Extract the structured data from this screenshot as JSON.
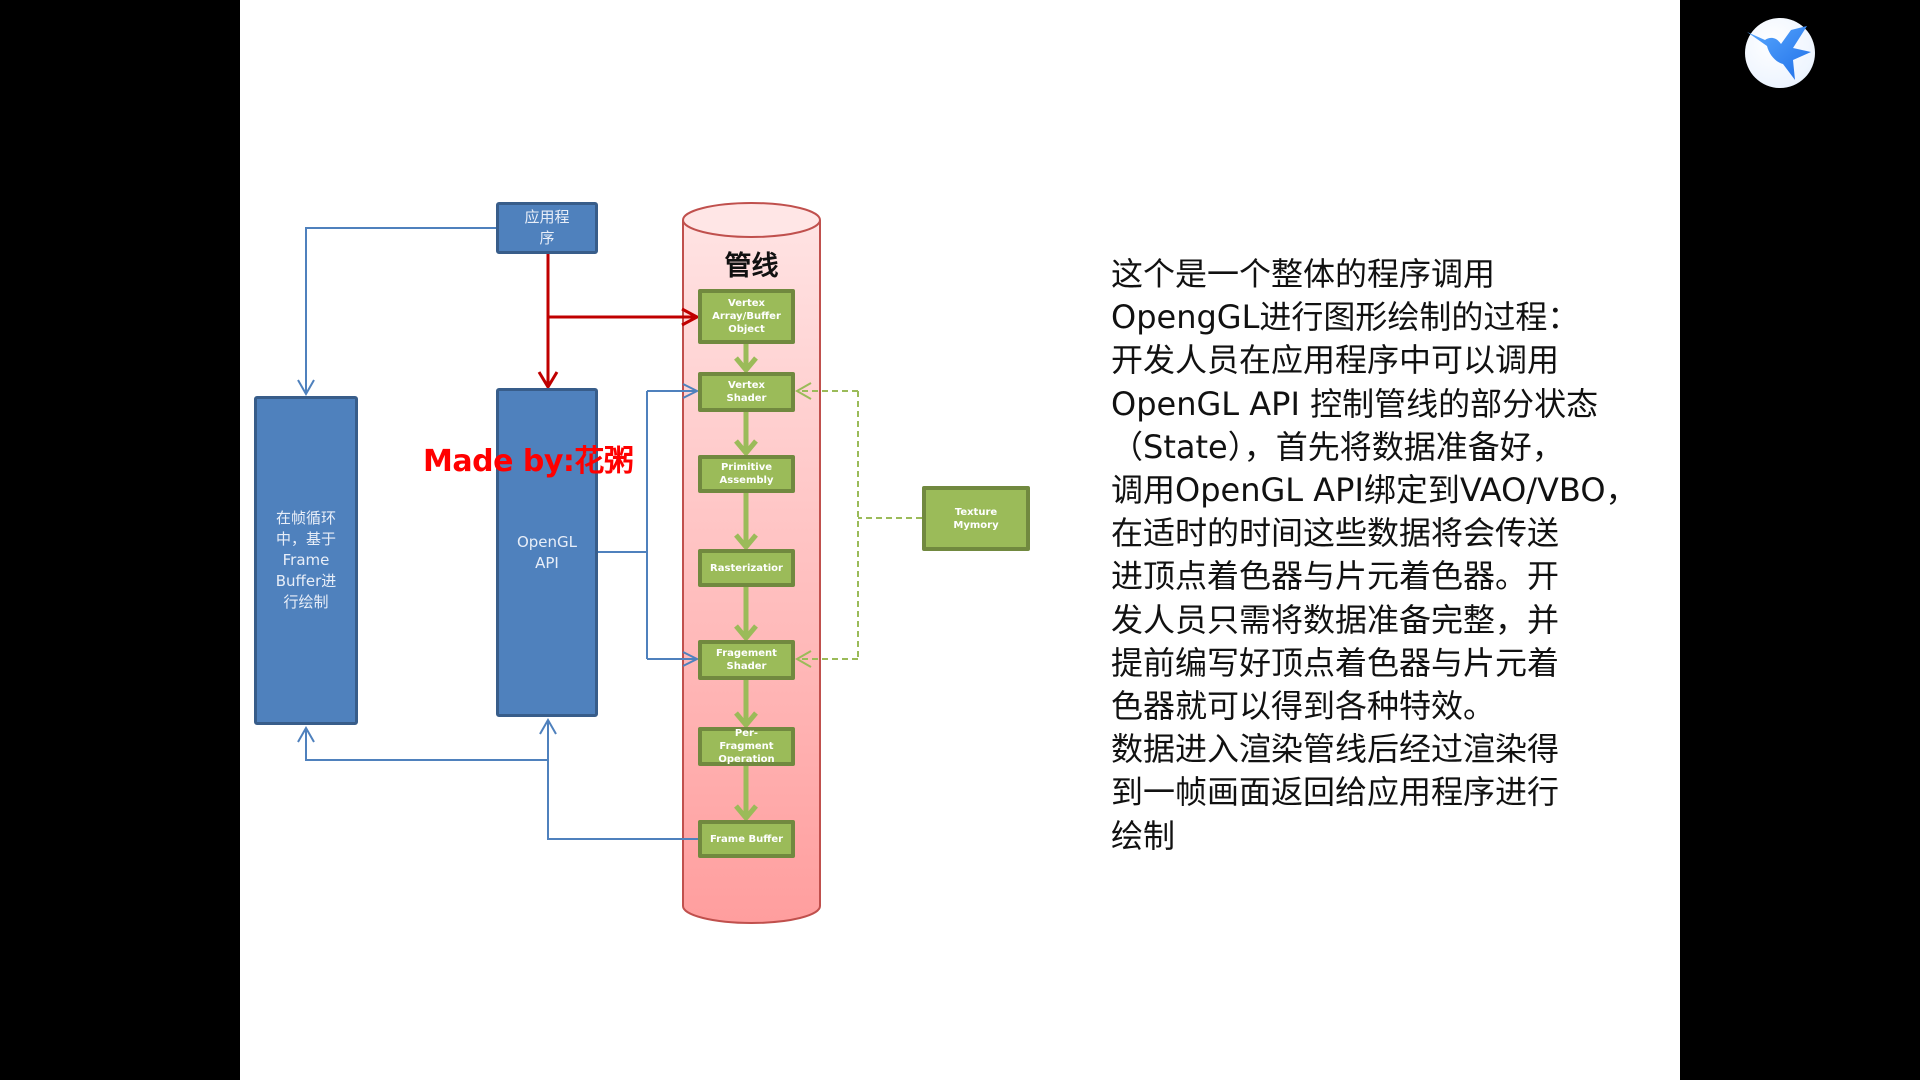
{
  "slide": {
    "diagram": {
      "app_box": "应用程序\n序",
      "app_box_label": "应用程\n序",
      "render_loop_box": "在帧循环\n中，基于\nFrame\nBuffer进\n行绘制",
      "opengl_api_box": "OpenGL\nAPI",
      "pipeline_title": "管线",
      "stages": [
        "Vertex\nArray/Buffer\nObject",
        "Vertex\nShader",
        "Primitive\nAssembly",
        "Rasterizatior",
        "Fragement\nShader",
        "Per-\nFragment\nOperation",
        "Frame Buffer"
      ],
      "texture_box": "Texture\nMymory",
      "watermark": "Made by:花粥",
      "colors": {
        "blue_fill": "#4f81bd",
        "blue_border": "#385d8a",
        "green_fill": "#9bbb59",
        "green_border": "#71893f",
        "red_arrow": "#c00000",
        "cylinder_fill": "#ffc7c7",
        "cylinder_border": "#c0504d",
        "watermark": "#ff0000"
      }
    },
    "description_lines": [
      "这个是一个整体的程序调用",
      "OpengGL进行图形绘制的过程：",
      "开发人员在应用程序中可以调用",
      "OpenGL API 控制管线的部分状态",
      "（State），首先将数据准备好，",
      "调用OpenGL API绑定到VAO/VBO，",
      "在适时的时间这些数据将会传送",
      "进顶点着色器与片元着色器。开",
      "发人员只需将数据准备完整，并",
      "提前编写好顶点着色器与片元着",
      "色器就可以得到各种特效。",
      "数据进入渲染管线后经过渲染得",
      "到一帧画面返回给应用程序进行",
      "绘制"
    ]
  },
  "overlay": {
    "app_icon": "hummingbird-icon"
  }
}
